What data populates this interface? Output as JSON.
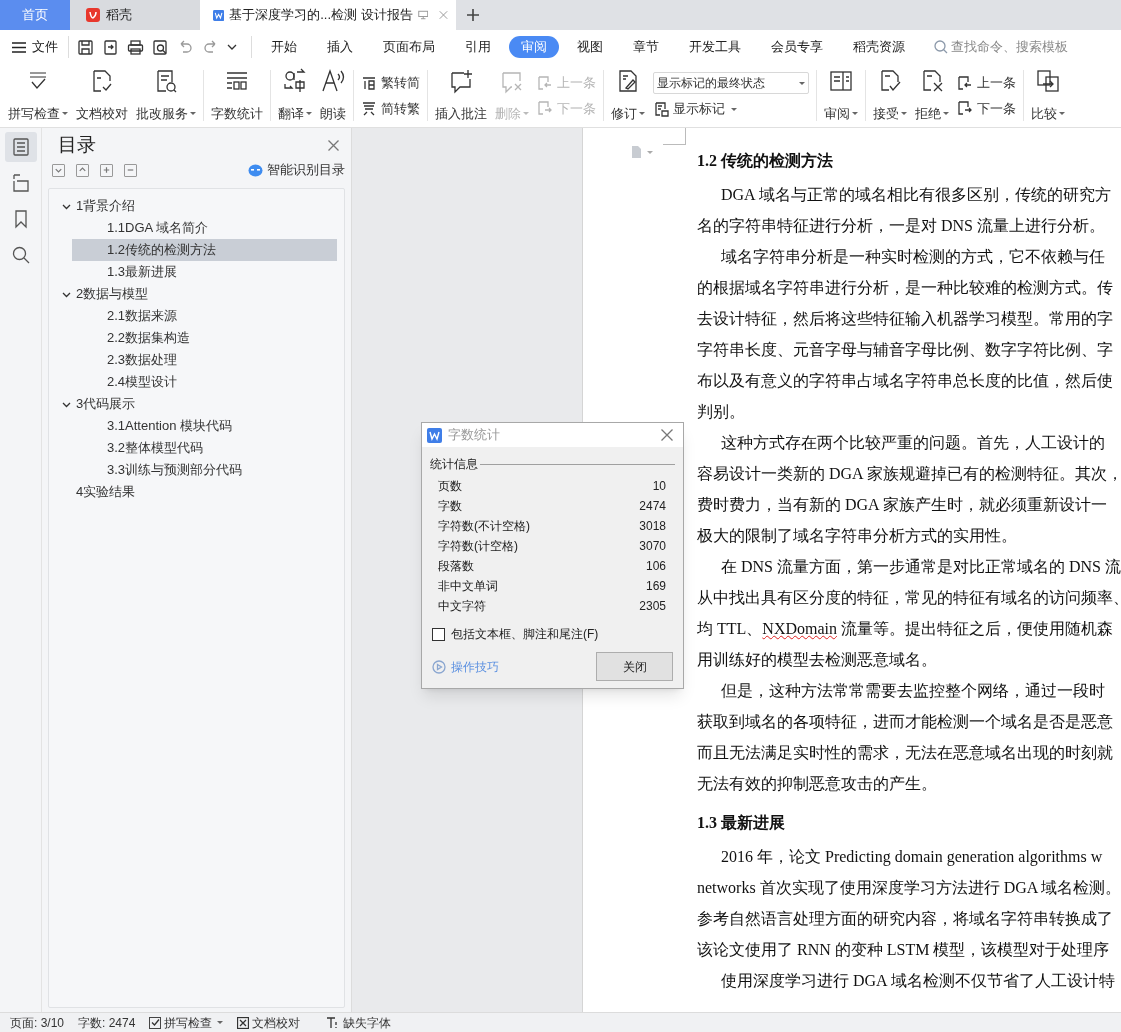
{
  "tabs": [
    {
      "label": "首页",
      "kind": "home",
      "selected": false
    },
    {
      "label": "稻壳",
      "kind": "app",
      "selected": false
    },
    {
      "label": "基于深度学习的...检测 设计报告",
      "kind": "document",
      "selected": true
    }
  ],
  "menu": {
    "file": "文件",
    "tabs": [
      {
        "label": "开始",
        "selected": false
      },
      {
        "label": "插入",
        "selected": false
      },
      {
        "label": "页面布局",
        "selected": false
      },
      {
        "label": "引用",
        "selected": false
      },
      {
        "label": "审阅",
        "selected": true
      },
      {
        "label": "视图",
        "selected": false
      },
      {
        "label": "章节",
        "selected": false
      },
      {
        "label": "开发工具",
        "selected": false
      },
      {
        "label": "会员专享",
        "selected": false
      },
      {
        "label": "稻壳资源",
        "selected": false
      }
    ],
    "search": {
      "placeholder": "查找命令、搜索模板"
    }
  },
  "ribbon": [
    [
      {
        "kind": "large",
        "label": "拼写检查",
        "dropdown": true,
        "disabled": false
      },
      {
        "kind": "large",
        "label": "文档校对",
        "dropdown": false,
        "disabled": false
      },
      {
        "kind": "large",
        "label": "批改服务",
        "dropdown": true,
        "disabled": false
      }
    ],
    [
      {
        "kind": "large",
        "label": "字数统计",
        "dropdown": false,
        "disabled": false
      }
    ],
    [
      {
        "kind": "large",
        "label": "翻译",
        "dropdown": true,
        "disabled": false
      },
      {
        "kind": "large",
        "label": "朗读",
        "dropdown": false,
        "disabled": false
      }
    ],
    [
      {
        "kind": "stack",
        "items": [
          {
            "label": "繁转简",
            "disabled": false
          },
          {
            "label": "简转繁",
            "disabled": false
          }
        ]
      }
    ],
    [
      {
        "kind": "large",
        "label": "插入批注",
        "dropdown": false,
        "disabled": false
      },
      {
        "kind": "large",
        "label": "删除",
        "dropdown": true,
        "disabled": true
      },
      {
        "kind": "stack",
        "items": [
          {
            "label": "上一条",
            "disabled": true
          },
          {
            "label": "下一条",
            "disabled": true
          }
        ]
      }
    ],
    [
      {
        "kind": "large",
        "label": "修订",
        "dropdown": true,
        "disabled": false
      },
      {
        "kind": "select",
        "value": "显示标记的最终状态",
        "button": {
          "label": "显示标记",
          "dropdown": true
        }
      }
    ],
    [
      {
        "kind": "large",
        "label": "审阅",
        "dropdown": true,
        "disabled": false
      }
    ],
    [
      {
        "kind": "large",
        "label": "接受",
        "dropdown": true,
        "disabled": false
      },
      {
        "kind": "large",
        "label": "拒绝",
        "dropdown": true,
        "disabled": false
      },
      {
        "kind": "stack",
        "items": [
          {
            "label": "上一条",
            "disabled": false
          },
          {
            "label": "下一条",
            "disabled": false
          }
        ]
      }
    ],
    [
      {
        "kind": "large",
        "label": "比较",
        "dropdown": true,
        "disabled": false
      }
    ]
  ],
  "rail": [
    {
      "selected": true
    },
    {
      "selected": false
    },
    {
      "selected": false
    },
    {
      "selected": false
    }
  ],
  "toc_panel": {
    "title": "目录",
    "smart_button": "智能识别目录",
    "items": [
      {
        "label": "1背景介绍",
        "expanded": true,
        "selected": false,
        "children": [
          {
            "label": "1.1DGA 域名简介",
            "selected": false
          },
          {
            "label": "1.2传统的检测方法",
            "selected": true
          },
          {
            "label": "1.3最新进展",
            "selected": false
          }
        ]
      },
      {
        "label": "2数据与模型",
        "expanded": true,
        "selected": false,
        "children": [
          {
            "label": "2.1数据来源",
            "selected": false
          },
          {
            "label": "2.2数据集构造",
            "selected": false
          },
          {
            "label": "2.3数据处理",
            "selected": false
          },
          {
            "label": "2.4模型设计",
            "selected": false
          }
        ]
      },
      {
        "label": "3代码展示",
        "expanded": true,
        "selected": false,
        "children": [
          {
            "label": "3.1Attention 模块代码",
            "selected": false
          },
          {
            "label": "3.2整体模型代码",
            "selected": false
          },
          {
            "label": "3.3训练与预测部分代码",
            "selected": false
          }
        ]
      },
      {
        "label": "4实验结果",
        "selected": false
      }
    ]
  },
  "document": [
    {
      "kind": "heading",
      "text": "1.2  传统的检测方法"
    },
    {
      "kind": "line",
      "indent": true,
      "text": "DGA 域名与正常的域名相比有很多区别，传统的研究方"
    },
    {
      "kind": "line",
      "indent": false,
      "text": "名的字符串特征进行分析，一是对 DNS 流量上进行分析。"
    },
    {
      "kind": "line",
      "indent": true,
      "text": "域名字符串分析是一种实时检测的方式，它不依赖与任"
    },
    {
      "kind": "line",
      "indent": false,
      "text": "的根据域名字符串进行分析，是一种比较难的检测方式。传"
    },
    {
      "kind": "line",
      "indent": false,
      "text": "去设计特征，然后将这些特征输入机器学习模型。常用的字"
    },
    {
      "kind": "line",
      "indent": false,
      "text": "字符串长度、元音字母与辅音字母比例、数字字符比例、字"
    },
    {
      "kind": "line",
      "indent": false,
      "text": "布以及有意义的字符串占域名字符串总长度的比值，然后使"
    },
    {
      "kind": "line",
      "indent": false,
      "text": "判别。"
    },
    {
      "kind": "line",
      "indent": true,
      "text": "这种方式存在两个比较严重的问题。首先，人工设计的"
    },
    {
      "kind": "line",
      "indent": false,
      "text": "容易设计一类新的 DGA 家族规避掉已有的检测特征。其次，"
    },
    {
      "kind": "line",
      "indent": false,
      "text": "费时费力，当有新的 DGA 家族产生时，就必须重新设计一"
    },
    {
      "kind": "line",
      "indent": false,
      "text": "极大的限制了域名字符串分析方式的实用性。"
    },
    {
      "kind": "line",
      "indent": true,
      "text": "在 DNS 流量方面，第一步通常是对比正常域名的 DNS 流"
    },
    {
      "kind": "line",
      "indent": false,
      "text": "从中找出具有区分度的特征，常见的特征有域名的访问频率、"
    },
    {
      "kind": "line",
      "indent": false,
      "segments": [
        {
          "text": "均 TTL、",
          "misspelled": false
        },
        {
          "text": "NXDomain",
          "misspelled": true
        },
        {
          "text": " 流量等。提出特征之后，便使用随机森",
          "misspelled": false
        }
      ]
    },
    {
      "kind": "line",
      "indent": false,
      "text": "用训练好的模型去检测恶意域名。"
    },
    {
      "kind": "line",
      "indent": true,
      "text": "但是，这种方法常常需要去监控整个网络，通过一段时"
    },
    {
      "kind": "line",
      "indent": false,
      "text": "获取到域名的各项特征，进而才能检测一个域名是否是恶意"
    },
    {
      "kind": "line",
      "indent": false,
      "text": "而且无法满足实时性的需求，无法在恶意域名出现的时刻就"
    },
    {
      "kind": "line",
      "indent": false,
      "text": "无法有效的抑制恶意攻击的产生。"
    },
    {
      "kind": "heading",
      "text": "1.3  最新进展"
    },
    {
      "kind": "line",
      "indent": true,
      "text": "2016 年，论文 Predicting domain generation algorithms w"
    },
    {
      "kind": "line",
      "indent": false,
      "text": "networks 首次实现了使用深度学习方法进行 DGA 域名检测。"
    },
    {
      "kind": "line",
      "indent": false,
      "text": "参考自然语言处理方面的研究内容，将域名字符串转换成了"
    },
    {
      "kind": "line",
      "indent": false,
      "text": "该论文使用了 RNN 的变种 LSTM 模型，该模型对于处理序"
    },
    {
      "kind": "line",
      "indent": true,
      "text": "使用深度学习进行 DGA 域名检测不仅节省了人工设计特"
    }
  ],
  "dialog": {
    "title": "字数统计",
    "section": "统计信息",
    "stats": [
      {
        "label": "页数",
        "value": "10"
      },
      {
        "label": "字数",
        "value": "2474"
      },
      {
        "label": "字符数(不计空格)",
        "value": "3018"
      },
      {
        "label": "字符数(计空格)",
        "value": "3070"
      },
      {
        "label": "段落数",
        "value": "106"
      },
      {
        "label": "非中文单词",
        "value": "169"
      },
      {
        "label": "中文字符",
        "value": "2305"
      }
    ],
    "checkbox": {
      "label": "包括文本框、脚注和尾注(F)",
      "checked": false
    },
    "tips": "操作技巧",
    "close_button": "关闭"
  },
  "status_bar": {
    "page": "页面: 3/10",
    "words": "字数: 2474",
    "spell_check": {
      "label": "拼写检查",
      "checked": true
    },
    "proofread": "文档校对",
    "fonts": "缺失字体"
  }
}
